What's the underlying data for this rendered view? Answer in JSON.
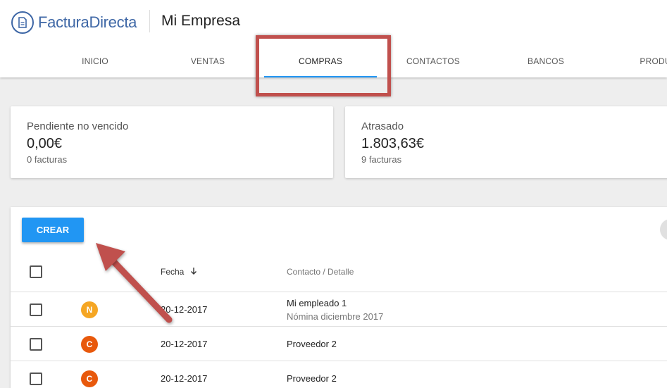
{
  "app": {
    "brand": "FacturaDirecta",
    "company": "Mi Empresa"
  },
  "tabs": [
    {
      "label": "INICIO"
    },
    {
      "label": "VENTAS"
    },
    {
      "label": "COMPRAS"
    },
    {
      "label": "CONTACTOS"
    },
    {
      "label": "BANCOS"
    },
    {
      "label": "PRODUC"
    }
  ],
  "active_tab": "COMPRAS",
  "summary": [
    {
      "label": "Pendiente no vencido",
      "amount": "0,00€",
      "count": "0 facturas"
    },
    {
      "label": "Atrasado",
      "amount": "1.803,63€",
      "count": "9 facturas"
    }
  ],
  "create_label": "CREAR",
  "table": {
    "headers": {
      "date": "Fecha",
      "contact": "Contacto / Detalle"
    },
    "rows": [
      {
        "avatar": "N",
        "avatar_color": "#f5a623",
        "date": "20-12-2017",
        "contact": "Mi empleado 1",
        "detail": "Nómina diciembre 2017"
      },
      {
        "avatar": "C",
        "avatar_color": "#e8590c",
        "date": "20-12-2017",
        "contact": "Proveedor 2",
        "detail": ""
      },
      {
        "avatar": "C",
        "avatar_color": "#e8590c",
        "date": "20-12-2017",
        "contact": "Proveedor 2",
        "detail": ""
      }
    ]
  },
  "colors": {
    "brand": "#3e67a6",
    "accent": "#2196f3",
    "annotation": "#c0504d"
  },
  "icons": [
    "document-icon",
    "sort-down-icon",
    "checkbox-icon"
  ]
}
